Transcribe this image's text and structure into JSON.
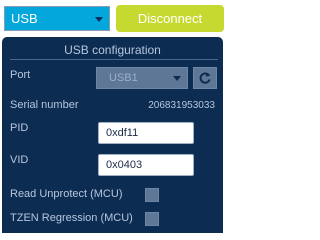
{
  "topbar": {
    "interface_select": {
      "value": "USB"
    },
    "disconnect_label": "Disconnect"
  },
  "colors": {
    "select_bg": "#04a7dc",
    "disconnect_bg": "#c6d930",
    "panel_bg": "#0d2c52",
    "disabled_control": "#5f7797"
  },
  "panel": {
    "title": "USB configuration",
    "port": {
      "label": "Port",
      "value": "USB1",
      "refresh_icon": "refresh-icon"
    },
    "serial_number": {
      "label": "Serial number",
      "value": "206831953033"
    },
    "pid": {
      "label": "PID",
      "value": "0xdf11"
    },
    "vid": {
      "label": "VID",
      "value": "0x0403"
    },
    "read_unprotect": {
      "label": "Read Unprotect (MCU)",
      "checked": false
    },
    "tzen_regression": {
      "label": "TZEN Regression (MCU)",
      "checked": false
    }
  }
}
